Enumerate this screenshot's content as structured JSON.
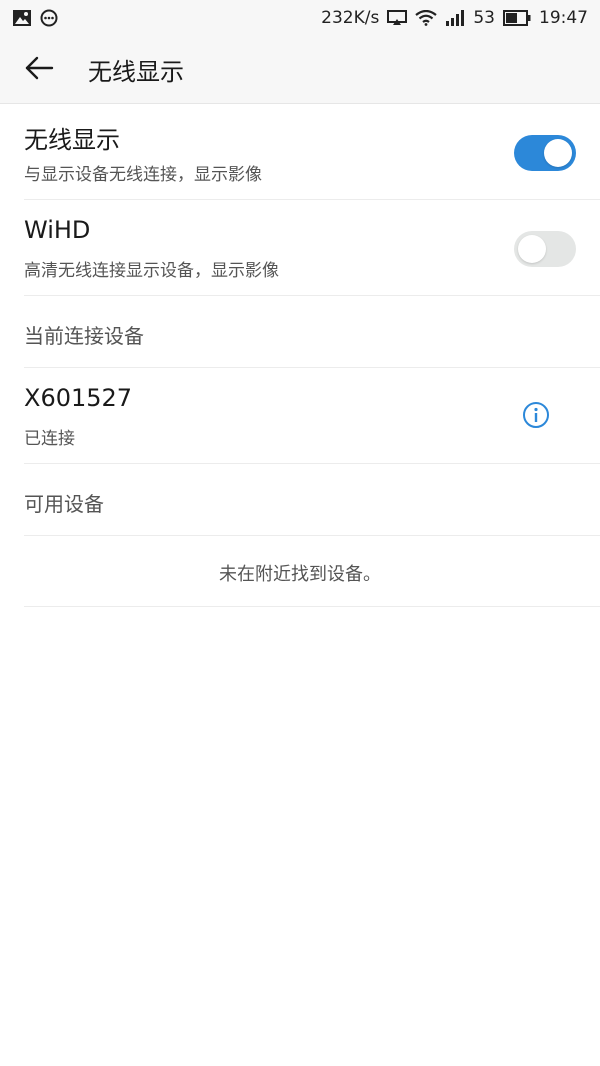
{
  "status_bar": {
    "speed": "232K/s",
    "battery": "53",
    "time": "19:47",
    "icons": [
      "gallery-icon",
      "message-icon",
      "cast-icon",
      "wifi-icon",
      "signal-icon",
      "battery-icon"
    ]
  },
  "header": {
    "title": "无线显示",
    "back_icon": "arrow-left-icon"
  },
  "settings": [
    {
      "title": "无线显示",
      "subtitle": "与显示设备无线连接，显示影像",
      "enabled": true
    },
    {
      "title": "WiHD",
      "subtitle": "高清无线连接显示设备，显示影像",
      "enabled": false
    }
  ],
  "current_devices": {
    "label": "当前连接设备",
    "items": [
      {
        "name": "X601527",
        "status": "已连接",
        "icon": "info-icon"
      }
    ]
  },
  "available_devices": {
    "label": "可用设备",
    "empty_text": "未在附近找到设备。"
  },
  "colors": {
    "accent": "#2c88d9",
    "toggle_off": "#e4e6e5",
    "header_bg": "#f7f7f7"
  }
}
